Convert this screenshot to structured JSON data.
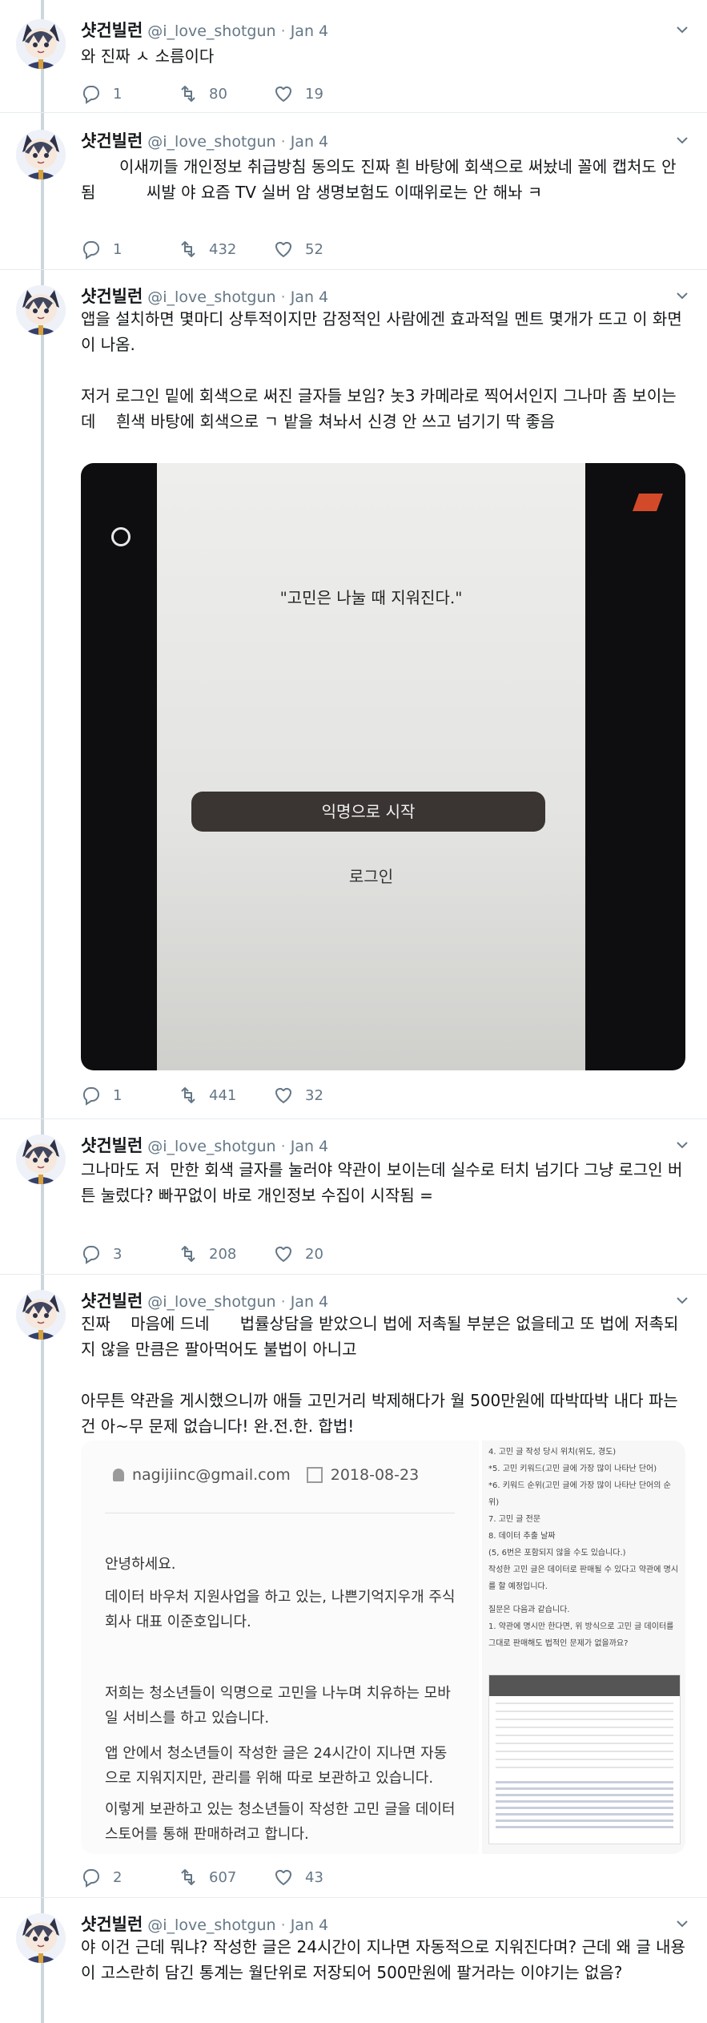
{
  "user": {
    "display_name": "샷건빌런",
    "handle": "@i_love_shotgun",
    "separator": "·"
  },
  "tweets": [
    {
      "date": "Jan 4",
      "text": "와 진짜 ㅅ 소름이다",
      "stats": {
        "replies": "1",
        "retweets": "80",
        "likes": "19"
      }
    },
    {
      "date": "Jan 4",
      "text": "이새끼들 개인정보 취급방침 동의도 진짜 흰 바탕에 회색으로 써놨네 꼴에 캡처도 안됨          씨발 야 요즘 TV 실버 암 생명보험도 이때위로는 안 해놔 ㅋ",
      "stats": {
        "replies": "1",
        "retweets": "432",
        "likes": "52"
      }
    },
    {
      "date": "Jan 4",
      "text": "앱을 설치하면 몇마디 상투적이지만 감정적인 사람에겐 효과적일 멘트 몇개가 뜨고 이 화면이 나옴.\n\n저거 로그인 밑에 회색으로 써진 글자들 보임? 놋3 카메라로 찍어서인지 그나마 좀 보이는데    흰색 바탕에 회색으로 ㄱ 밭을 쳐놔서 신경 안 쓰고 넘기기 딱 좋음",
      "media": {
        "quote": "\"고민은 나눌 때 지워진다.\"",
        "primary_button": "익명으로 시작",
        "secondary_link": "로그인"
      },
      "stats": {
        "replies": "1",
        "retweets": "441",
        "likes": "32"
      }
    },
    {
      "date": "Jan 4",
      "text": "그나마도 저  만한 회색 글자를 눌러야 약관이 보이는데 실수로 터치 넘기다 그냥 로그인 버튼 눌렀다? 빠꾸없이 바로 개인정보 수집이 시작됨 =",
      "stats": {
        "replies": "3",
        "retweets": "208",
        "likes": "20"
      }
    },
    {
      "date": "Jan 4",
      "text": "진짜    마음에 드네      법률상담을 받았으니 법에 저촉될 부분은 없을테고 또 법에 저촉되지 않을 만큼은 팔아먹어도 불법이 아니고\n\n아무튼 약관을 게시했으니까 애들 고민거리 박제해다가 월 500만원에 따박따박 내다 파는건 아~무 문제 없습니다! 완.전.한. 합법!",
      "media": {
        "email": "nagijiinc@gmail.com",
        "date": "2018-08-23",
        "greeting": "안녕하세요.",
        "para1": "데이터 바우처 지원사업을 하고 있는, 나쁜기억지우개 주식회사 대표 이준호입니다.",
        "para2": "저희는 청소년들이 익명으로 고민을 나누며 치유하는 모바일 서비스를 하고 있습니다.",
        "para3": "앱 안에서 청소년들이 작성한 글은 24시간이 지나면 자동으로 지워지지만, 관리를 위해 따로 보관하고 있습니다.",
        "para4": "이렇게 보관하고 있는 청소년들이 작성한 고민 글을 데이터 스토어를 통해 판매하려고 합니다.",
        "list": [
          "4. 고민 글 작성 당시 위치(위도, 경도)",
          "*5. 고민 키워드(고민 글에 가장 많이 나타난 단어)",
          "*6. 키워드 순위(고민 글에 가장 많이 나타난 단어의 순위)",
          "7. 고민 글 전문",
          "8. 데이터 추출 날짜",
          "(5, 6번은 포함되지 않을 수도 있습니다.)",
          "작성한 고민 글은 데이터로 판매될 수 있다고 약관에 명시를 할 예정입니다.",
          "질문은 다음과 같습니다.",
          "1. 약관에 명시만 한다면, 위 방식으로 고민 글 데이터를 그대로 판매해도 법적인 문제가 없을까요?"
        ]
      },
      "stats": {
        "replies": "2",
        "retweets": "607",
        "likes": "43"
      }
    },
    {
      "date": "Jan 4",
      "text": "야 이건 근데 뭐냐? 작성한 글은 24시간이 지나면 자동적으로 지워진다며? 근데 왜 글 내용이 고스란히 담긴 통계는 월단위로 저장되어 500만원에 팔거라는 이야기는 없음?"
    }
  ]
}
